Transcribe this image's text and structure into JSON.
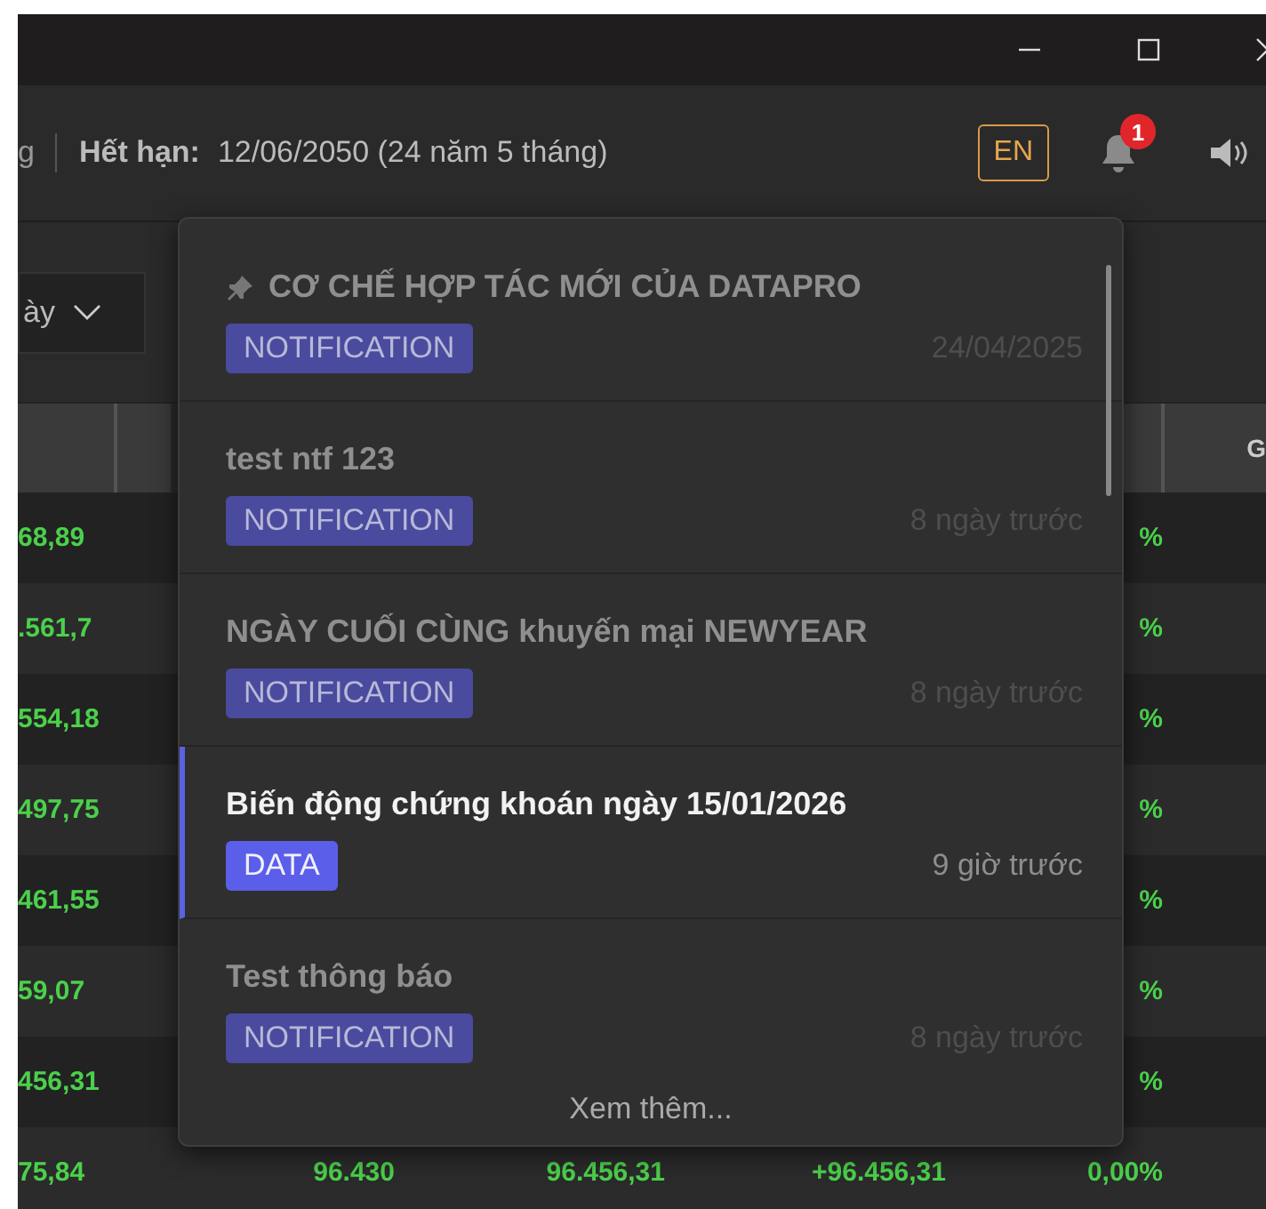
{
  "window": {
    "controls": [
      {
        "kind": "minimize"
      },
      {
        "kind": "maximize"
      },
      {
        "kind": "close"
      }
    ]
  },
  "header": {
    "cut_text": "g",
    "expiry_label": "Hết hạn:",
    "expiry_value": "12/06/2050 (24 năm 5 tháng)",
    "language": "EN",
    "notification_count": "1"
  },
  "period_select": {
    "value": "ày"
  },
  "table": {
    "header_cut": "G",
    "rows": [
      {
        "cells": [
          "68,89",
          null,
          null,
          null,
          "%"
        ]
      },
      {
        "cells": [
          ".561,7",
          null,
          null,
          null,
          "%"
        ]
      },
      {
        "cells": [
          "554,18",
          null,
          null,
          null,
          "%"
        ]
      },
      {
        "cells": [
          "497,75",
          null,
          null,
          null,
          "%"
        ]
      },
      {
        "cells": [
          "461,55",
          null,
          null,
          null,
          "%"
        ]
      },
      {
        "cells": [
          "59,07",
          null,
          null,
          null,
          "%"
        ]
      },
      {
        "cells": [
          "456,31",
          null,
          null,
          null,
          "%"
        ]
      },
      {
        "cells": [
          "75,84",
          "96.430",
          "96.456,31",
          "+96.456,31",
          "0,00%"
        ]
      }
    ]
  },
  "notifications": {
    "items": [
      {
        "title": "CƠ CHẾ HỢP TÁC MỚI CỦA DATAPRO",
        "tag": "NOTIFICATION",
        "time": "24/04/2025",
        "pinned": true,
        "read": true
      },
      {
        "title": "test ntf 123",
        "tag": "NOTIFICATION",
        "time": "8 ngày trước",
        "pinned": false,
        "read": true
      },
      {
        "title": "NGÀY CUỐI CÙNG khuyến mại NEWYEAR",
        "tag": "NOTIFICATION",
        "time": "8 ngày trước",
        "pinned": false,
        "read": true
      },
      {
        "title": "Biến động chứng khoán ngày 15/01/2026",
        "tag": "DATA",
        "time": "9 giờ trước",
        "pinned": false,
        "read": false
      },
      {
        "title": "Test thông báo",
        "tag": "NOTIFICATION",
        "time": "8 ngày trước",
        "pinned": false,
        "read": true
      }
    ],
    "more": "Xem thêm..."
  }
}
